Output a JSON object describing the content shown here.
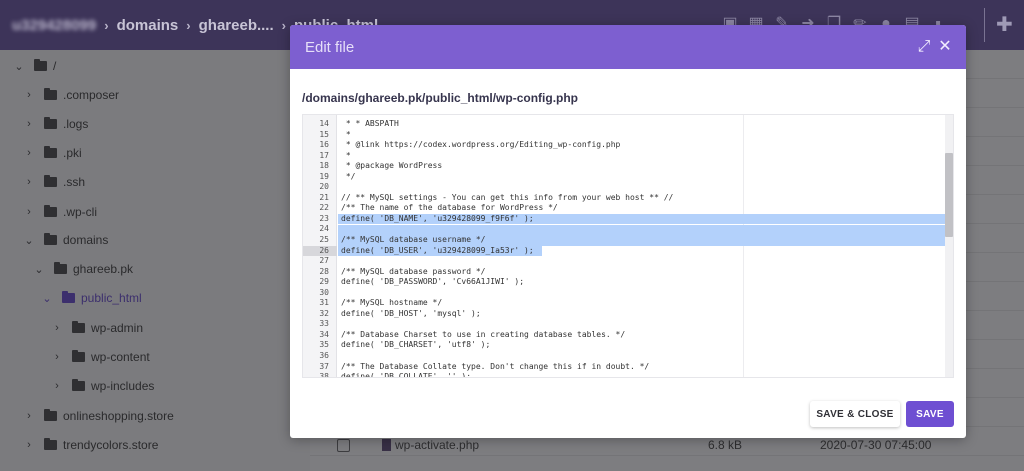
{
  "topbar": {
    "account": "u329428099",
    "sep": "›",
    "crumbs": [
      "domains",
      "ghareeb....",
      "public_html"
    ],
    "tool_icons": [
      "folder-icon",
      "new-file-icon",
      "edit-icon",
      "move-icon",
      "copy-icon",
      "rename-icon",
      "permissions-icon",
      "archive-icon",
      "delete-icon"
    ],
    "upload_icon": "upload-file-icon"
  },
  "tree": {
    "items": [
      {
        "label": "/",
        "depth": 0,
        "expanded": true,
        "active": false
      },
      {
        "label": ".composer",
        "depth": 1,
        "expanded": false,
        "active": false
      },
      {
        "label": ".logs",
        "depth": 1,
        "expanded": false,
        "active": false
      },
      {
        "label": ".pki",
        "depth": 1,
        "expanded": false,
        "active": false
      },
      {
        "label": ".ssh",
        "depth": 1,
        "expanded": false,
        "active": false
      },
      {
        "label": ".wp-cli",
        "depth": 1,
        "expanded": false,
        "active": false
      },
      {
        "label": "domains",
        "depth": 1,
        "expanded": true,
        "active": false
      },
      {
        "label": "ghareeb.pk",
        "depth": 2,
        "expanded": true,
        "active": false
      },
      {
        "label": "public_html",
        "depth": 3,
        "expanded": true,
        "active": true
      },
      {
        "label": "wp-admin",
        "depth": 4,
        "expanded": false,
        "active": false
      },
      {
        "label": "wp-content",
        "depth": 4,
        "expanded": false,
        "active": false
      },
      {
        "label": "wp-includes",
        "depth": 4,
        "expanded": false,
        "active": false
      },
      {
        "label": "onlineshopping.store",
        "depth": 1,
        "expanded": false,
        "active": false
      },
      {
        "label": "trendycolors.store",
        "depth": 1,
        "expanded": false,
        "active": false
      }
    ]
  },
  "background_file": {
    "name": "wp-activate.php",
    "size": "6.8 kB",
    "date": "2020-07-30 07:45:00"
  },
  "modal": {
    "title": "Edit file",
    "fullscreen_icon": "fullscreen-icon",
    "close_icon": "close-icon",
    "file_path": "/domains/ghareeb.pk/public_html/wp-config.php",
    "save_close_label": "SAVE & CLOSE",
    "save_label": "SAVE"
  },
  "editor": {
    "highlight_color": "#b3d1fb",
    "selected_lines": [
      23,
      24,
      25,
      26
    ],
    "lines": [
      {
        "n": "14",
        "text": " * * ABSPATH"
      },
      {
        "n": "15",
        "text": " *"
      },
      {
        "n": "16",
        "text": " * @link https://codex.wordpress.org/Editing_wp-config.php"
      },
      {
        "n": "17",
        "text": " *"
      },
      {
        "n": "18",
        "text": " * @package WordPress"
      },
      {
        "n": "19",
        "text": " */"
      },
      {
        "n": "20",
        "text": ""
      },
      {
        "n": "21",
        "text": "// ** MySQL settings - You can get this info from your web host ** //"
      },
      {
        "n": "22",
        "text": "/** The name of the database for WordPress */"
      },
      {
        "n": "23",
        "text": "define( 'DB_NAME', 'u329428099_f9F6f' );"
      },
      {
        "n": "24",
        "text": ""
      },
      {
        "n": "25",
        "text": "/** MySQL database username */"
      },
      {
        "n": "26",
        "text": "define( 'DB_USER', 'u329428099_Ia53r' );"
      },
      {
        "n": "27",
        "text": ""
      },
      {
        "n": "28",
        "text": "/** MySQL database password */"
      },
      {
        "n": "29",
        "text": "define( 'DB_PASSWORD', 'Cv66A1JIWI' );"
      },
      {
        "n": "30",
        "text": ""
      },
      {
        "n": "31",
        "text": "/** MySQL hostname */"
      },
      {
        "n": "32",
        "text": "define( 'DB_HOST', 'mysql' );"
      },
      {
        "n": "33",
        "text": ""
      },
      {
        "n": "34",
        "text": "/** Database Charset to use in creating database tables. */"
      },
      {
        "n": "35",
        "text": "define( 'DB_CHARSET', 'utf8' );"
      },
      {
        "n": "36",
        "text": ""
      },
      {
        "n": "37",
        "text": "/** The Database Collate type. Don't change this if in doubt. */"
      },
      {
        "n": "38",
        "text": "define( 'DB_COLLATE', '' );"
      }
    ]
  }
}
